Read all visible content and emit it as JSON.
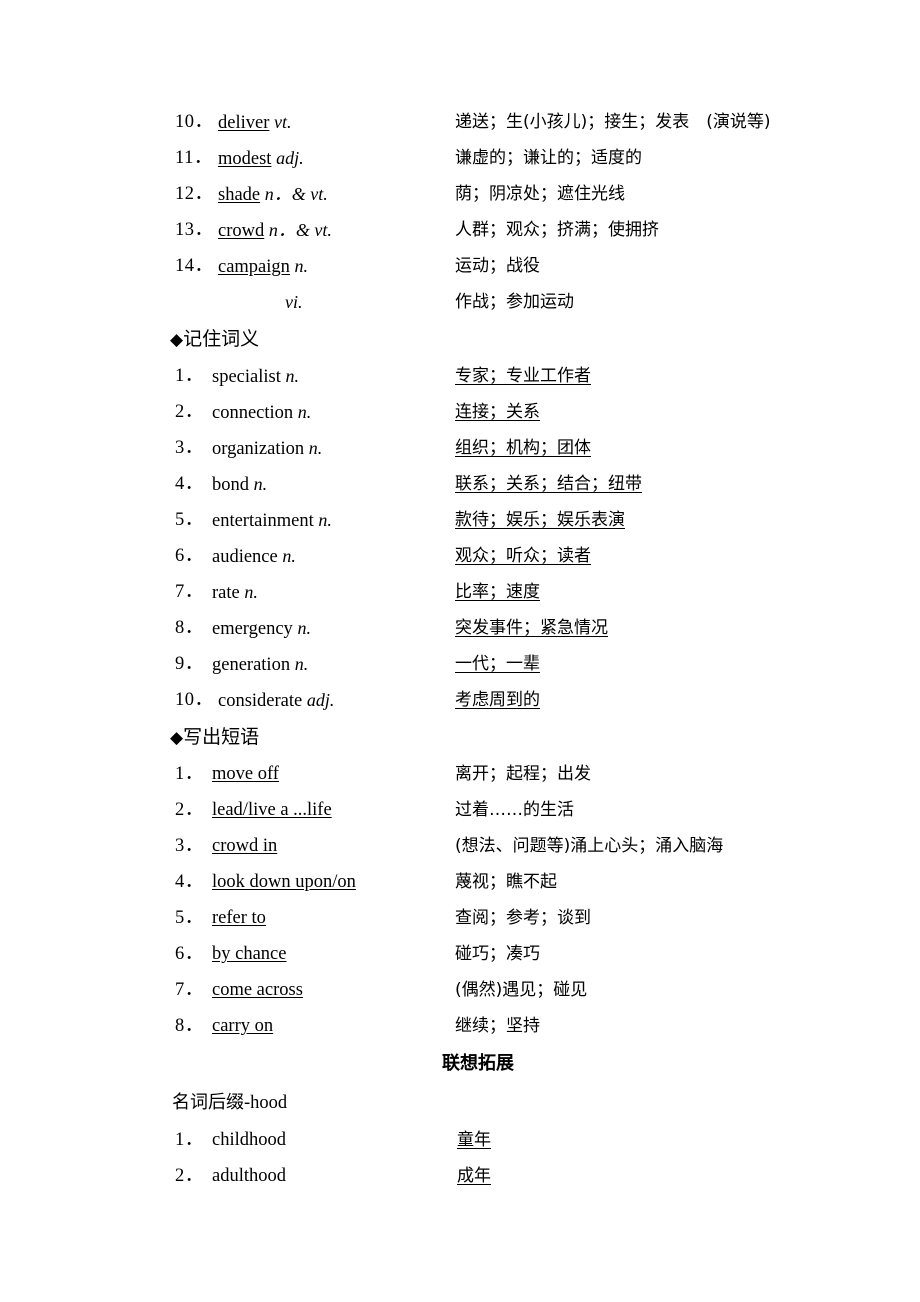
{
  "sections": [
    {
      "id": "word-forms-continued",
      "rows": [
        {
          "num": "10．",
          "term": "deliver",
          "term_underlined": true,
          "pos": "vt.",
          "meaning": "递送；生(小孩儿)；接生；发表　(演说等)",
          "meaning_underlined": false
        },
        {
          "num": "11．",
          "term": "modest",
          "term_underlined": true,
          "pos": "adj.",
          "meaning": "谦虚的；谦让的；适度的",
          "meaning_underlined": false
        },
        {
          "num": "12．",
          "term": "shade",
          "term_underlined": true,
          "pos": "n．& vt.",
          "meaning": "荫；阴凉处；遮住光线",
          "meaning_underlined": false
        },
        {
          "num": "13．",
          "term": "crowd",
          "term_underlined": true,
          "pos": "n．& vt.",
          "meaning": "人群；观众；挤满；使拥挤",
          "meaning_underlined": false
        },
        {
          "num": "14．",
          "term": "campaign",
          "term_underlined": true,
          "pos": "n.",
          "meaning": "运动；战役",
          "meaning_underlined": false
        },
        {
          "num": "",
          "term": "",
          "term_underlined": false,
          "pos": "vi.",
          "sub_pos_only": true,
          "meaning": "作战；参加运动",
          "meaning_underlined": false
        }
      ]
    },
    {
      "id": "remember-meaning",
      "heading": {
        "diamond": "◆",
        "label": "记住词义"
      },
      "rows": [
        {
          "num": "1．",
          "term": "specialist",
          "term_underlined": false,
          "pos": "n.",
          "meaning": "专家；专业工作者",
          "meaning_underlined": true
        },
        {
          "num": "2．",
          "term": "connection",
          "term_underlined": false,
          "pos": "n.",
          "meaning": "连接；关系",
          "meaning_underlined": true
        },
        {
          "num": "3．",
          "term": "organization",
          "term_underlined": false,
          "pos": "n.",
          "meaning": "组织；机构；团体",
          "meaning_underlined": true
        },
        {
          "num": "4．",
          "term": "bond",
          "term_underlined": false,
          "pos": "n.",
          "meaning": "联系；关系；结合；纽带",
          "meaning_underlined": true
        },
        {
          "num": "5．",
          "term": "entertainment",
          "term_underlined": false,
          "pos": "n.",
          "meaning": "款待；娱乐；娱乐表演",
          "meaning_underlined": true
        },
        {
          "num": "6．",
          "term": "audience",
          "term_underlined": false,
          "pos": "n.",
          "meaning": "观众；听众；读者",
          "meaning_underlined": true
        },
        {
          "num": "7．",
          "term": "rate",
          "term_underlined": false,
          "pos": "n.",
          "meaning": "比率；速度",
          "meaning_underlined": true
        },
        {
          "num": "8．",
          "term": "emergency",
          "term_underlined": false,
          "pos": "n.",
          "meaning": "突发事件；紧急情况",
          "meaning_underlined": true
        },
        {
          "num": "9．",
          "term": "generation",
          "term_underlined": false,
          "pos": "n.",
          "meaning": "一代；一辈",
          "meaning_underlined": true
        },
        {
          "num": "10．",
          "term": "considerate",
          "term_underlined": false,
          "pos": "adj.",
          "meaning": "考虑周到的",
          "meaning_underlined": true
        }
      ]
    },
    {
      "id": "write-phrases",
      "heading": {
        "diamond": "◆",
        "label": "写出短语"
      },
      "rows": [
        {
          "num": "1．",
          "term": "move off",
          "term_underlined": true,
          "pos": "",
          "meaning": "离开；起程；出发",
          "meaning_underlined": false
        },
        {
          "num": "2．",
          "term": "lead/live a ...life",
          "term_underlined": true,
          "pos": "",
          "meaning": "过着……的生活",
          "meaning_underlined": false
        },
        {
          "num": "3．",
          "term": "crowd in",
          "term_underlined": true,
          "pos": "",
          "meaning": "(想法、问题等)涌上心头；涌入脑海",
          "meaning_underlined": false
        },
        {
          "num": "4．",
          "term": "look down upon/on",
          "term_underlined": true,
          "pos": "",
          "meaning": "蔑视；瞧不起",
          "meaning_underlined": false
        },
        {
          "num": "5．",
          "term": "refer to",
          "term_underlined": true,
          "pos": "",
          "meaning": "查阅；参考；谈到",
          "meaning_underlined": false
        },
        {
          "num": "6．",
          "term": "by chance",
          "term_underlined": true,
          "pos": "",
          "meaning": "碰巧；凑巧",
          "meaning_underlined": false
        },
        {
          "num": "7．",
          "term": "come across",
          "term_underlined": true,
          "pos": "",
          "meaning": "(偶然)遇见；碰见",
          "meaning_underlined": false
        },
        {
          "num": "8．",
          "term": "carry on",
          "term_underlined": true,
          "pos": "",
          "meaning": "继续；坚持",
          "meaning_underlined": false
        }
      ]
    },
    {
      "id": "association-expansion",
      "center_heading": "联想拓展",
      "plain_heading": {
        "cn": "名词后缀",
        "en": "-hood"
      },
      "rows": [
        {
          "num": "1．",
          "term": "childhood",
          "term_underlined": false,
          "pos": "",
          "meaning": "童年",
          "meaning_underlined": true,
          "meaning_indent": true
        },
        {
          "num": "2．",
          "term": "adulthood",
          "term_underlined": false,
          "pos": "",
          "meaning": "成年",
          "meaning_underlined": true,
          "meaning_indent": true
        }
      ]
    }
  ]
}
